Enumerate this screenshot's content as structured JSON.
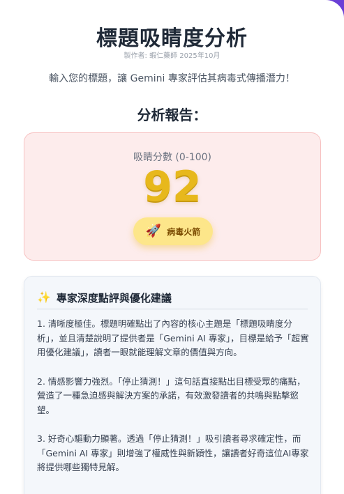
{
  "header": {
    "title": "標題吸睛度分析",
    "byline": "製作者: 蝦仁藥師 2025年10月",
    "intro": "輸入您的標題，讓 Gemini 專家評估其病毒式傳播潛力！"
  },
  "report": {
    "heading": "分析報告：",
    "score_label": "吸睛分數 (0-100)",
    "score_value": "92",
    "badge_icon": "rocket-icon",
    "badge_label": "病毒火箭"
  },
  "review": {
    "icon": "sparkle-icon",
    "title": "專家深度點評與優化建議",
    "items": [
      "1. 清晰度極佳。標題明確點出了內容的核心主題是「標題吸睛度分析」，並且清楚說明了提供者是「Gemini AI 專家」，目標是給予「超實用優化建議」，讀者一眼就能理解文章的價值與方向。",
      "2. 情感影響力強烈。「停止猜測！」這句話直接點出目標受眾的痛點，營造了一種急迫感與解決方案的承諾，有效激發讀者的共鳴與點擊慾望。",
      "3. 好奇心驅動力顯著。透過「停止猜測！」吸引讀者尋求確定性，而「Gemini AI 專家」則增強了權威性與新穎性，讓讀者好奇這位AI專家將提供哪些獨特見解。"
    ]
  },
  "colors": {
    "score": "#e7b81c",
    "score_panel_bg": "#fdecec",
    "badge_bg": "#fde68a"
  }
}
